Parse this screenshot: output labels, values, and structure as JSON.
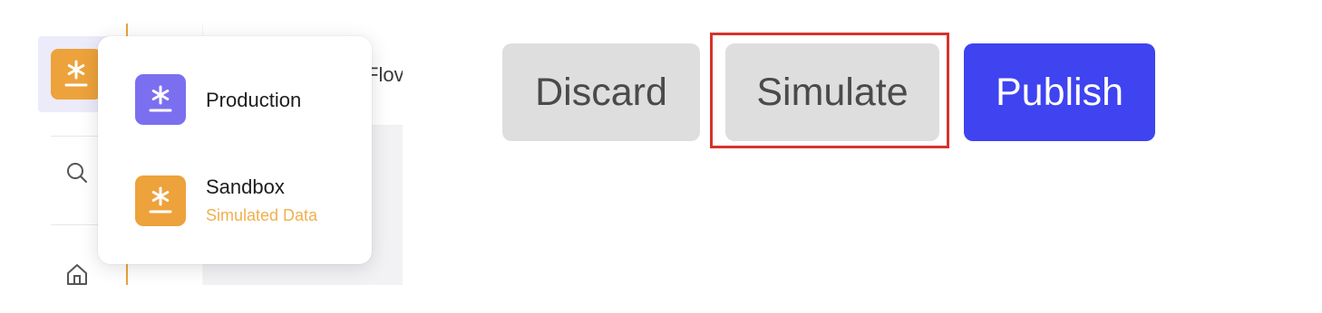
{
  "sidebar": {
    "current_env_icon": "asterisk-icon",
    "nav_icons": [
      "search-icon",
      "home-icon"
    ]
  },
  "header": {
    "flow_label_partial": "Flov"
  },
  "env_menu": {
    "items": [
      {
        "title": "Production",
        "subtitle": "",
        "icon": "asterisk-icon",
        "color": "#7b6ff0"
      },
      {
        "title": "Sandbox",
        "subtitle": "Simulated Data",
        "icon": "asterisk-icon",
        "color": "#eda23b"
      }
    ]
  },
  "actions": {
    "discard_label": "Discard",
    "simulate_label": "Simulate",
    "publish_label": "Publish"
  },
  "colors": {
    "brand": "#3f43f0",
    "sandbox": "#eda23b",
    "production": "#7b6ff0",
    "highlight": "#d5332c"
  }
}
